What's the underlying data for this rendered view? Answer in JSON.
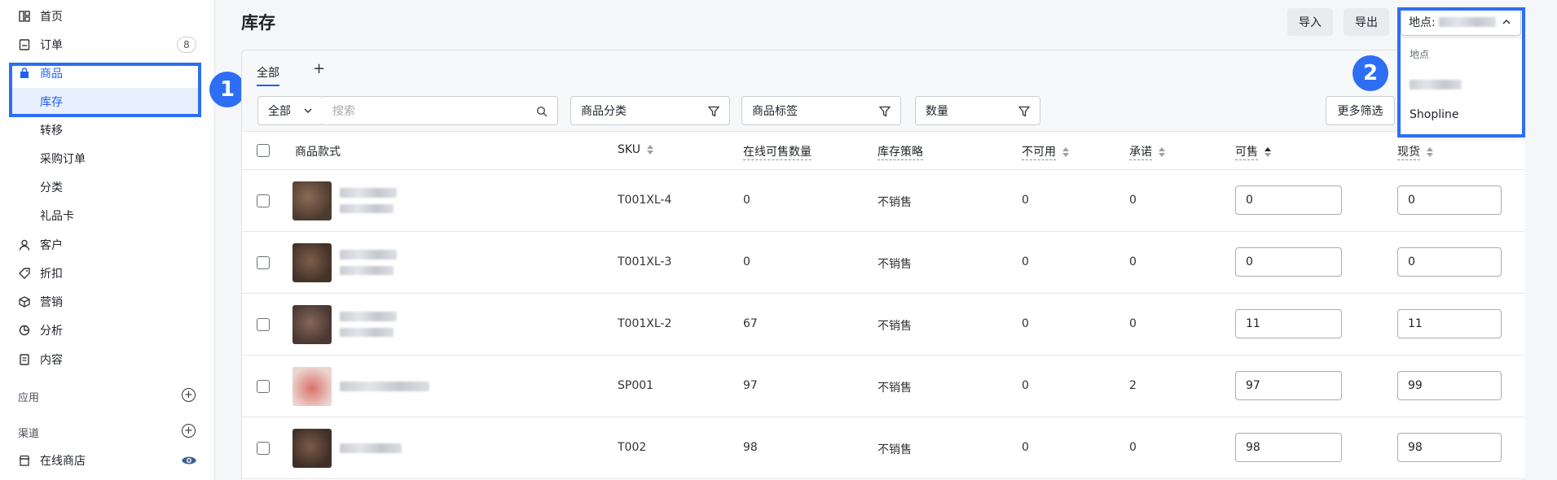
{
  "sidebar": {
    "items": [
      {
        "label": "首页",
        "icon": "dashboard-icon"
      },
      {
        "label": "订单",
        "icon": "order-icon",
        "badge": "8"
      },
      {
        "label": "商品",
        "icon": "bag-icon"
      },
      {
        "label": "库存"
      },
      {
        "label": "转移"
      },
      {
        "label": "采购订单"
      },
      {
        "label": "分类"
      },
      {
        "label": "礼品卡"
      },
      {
        "label": "客户",
        "icon": "person-icon"
      },
      {
        "label": "折扣",
        "icon": "tag-icon"
      },
      {
        "label": "营销",
        "icon": "cube-icon"
      },
      {
        "label": "分析",
        "icon": "pie-icon"
      },
      {
        "label": "内容",
        "icon": "doc-icon"
      }
    ],
    "apps_label": "应用",
    "channels_label": "渠道",
    "online_store_label": "在线商店"
  },
  "annotations": {
    "step1": "1",
    "step2": "2"
  },
  "header": {
    "title": "库存",
    "import_label": "导入",
    "export_label": "导出",
    "location_prefix": "地点:"
  },
  "tabs": {
    "all": "全部",
    "add": "+"
  },
  "filters": {
    "all_dropdown": "全部",
    "search_placeholder": "搜索",
    "category": "商品分类",
    "tags": "商品标签",
    "quantity": "数量",
    "more": "更多筛选"
  },
  "table": {
    "headers": {
      "product": "商品款式",
      "sku": "SKU",
      "online_qty": "在线可售数量",
      "policy": "库存策略",
      "unavailable": "不可用",
      "committed": "承诺",
      "available": "可售",
      "on_hand": "现货"
    },
    "rows": [
      {
        "sku": "T001XL-4",
        "online": "0",
        "policy": "不销售",
        "unavailable": "0",
        "committed": "0",
        "available": "0",
        "on_hand": "0"
      },
      {
        "sku": "T001XL-3",
        "online": "0",
        "policy": "不销售",
        "unavailable": "0",
        "committed": "0",
        "available": "0",
        "on_hand": "0"
      },
      {
        "sku": "T001XL-2",
        "online": "67",
        "policy": "不销售",
        "unavailable": "0",
        "committed": "0",
        "available": "11",
        "on_hand": "11"
      },
      {
        "sku": "SP001",
        "online": "97",
        "policy": "不销售",
        "unavailable": "0",
        "committed": "2",
        "available": "97",
        "on_hand": "99"
      },
      {
        "sku": "T002",
        "online": "98",
        "policy": "不销售",
        "unavailable": "0",
        "committed": "0",
        "available": "98",
        "on_hand": "98"
      }
    ]
  },
  "dropdown": {
    "heading": "地点",
    "option_shopline": "Shopline"
  },
  "colors": {
    "accent": "#1f5ff5",
    "highlight": "#2d6ef4"
  }
}
